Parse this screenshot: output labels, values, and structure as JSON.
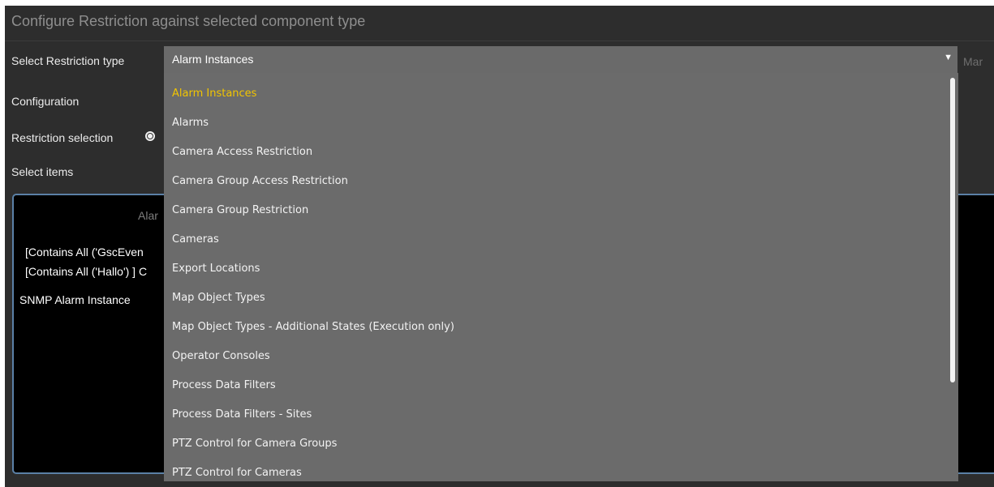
{
  "dialog": {
    "title": "Configure Restriction against selected component type"
  },
  "form": {
    "restriction_type_label": "Select Restriction type",
    "restriction_type_value": "Alarm Instances",
    "configuration_label": "Configuration",
    "restriction_selection_label": "Restriction selection",
    "select_items_label": "Select items",
    "right_truncated_text": "Mar"
  },
  "items_panel": {
    "header_partial": "Alar",
    "lines": [
      "[Contains All ('GscEven",
      "[Contains All ('Hallo') ] C",
      "SNMP Alarm Instance"
    ]
  },
  "dropdown": {
    "selected_index": 0,
    "options": [
      "Alarm Instances",
      "Alarms",
      "Camera Access Restriction",
      "Camera Group Access Restriction",
      "Camera Group Restriction",
      "Cameras",
      "Export Locations",
      "Map Object Types",
      "Map Object Types - Additional States (Execution only)",
      "Operator Consoles",
      "Process Data Filters",
      "Process Data Filters - Sites",
      "PTZ Control for Camera Groups",
      "PTZ Control for Cameras"
    ]
  },
  "colors": {
    "panel_background": "#2d2d2d",
    "dropdown_background": "#6b6b6b",
    "selected_option": "#f2c500",
    "items_border": "#5b80a6"
  }
}
